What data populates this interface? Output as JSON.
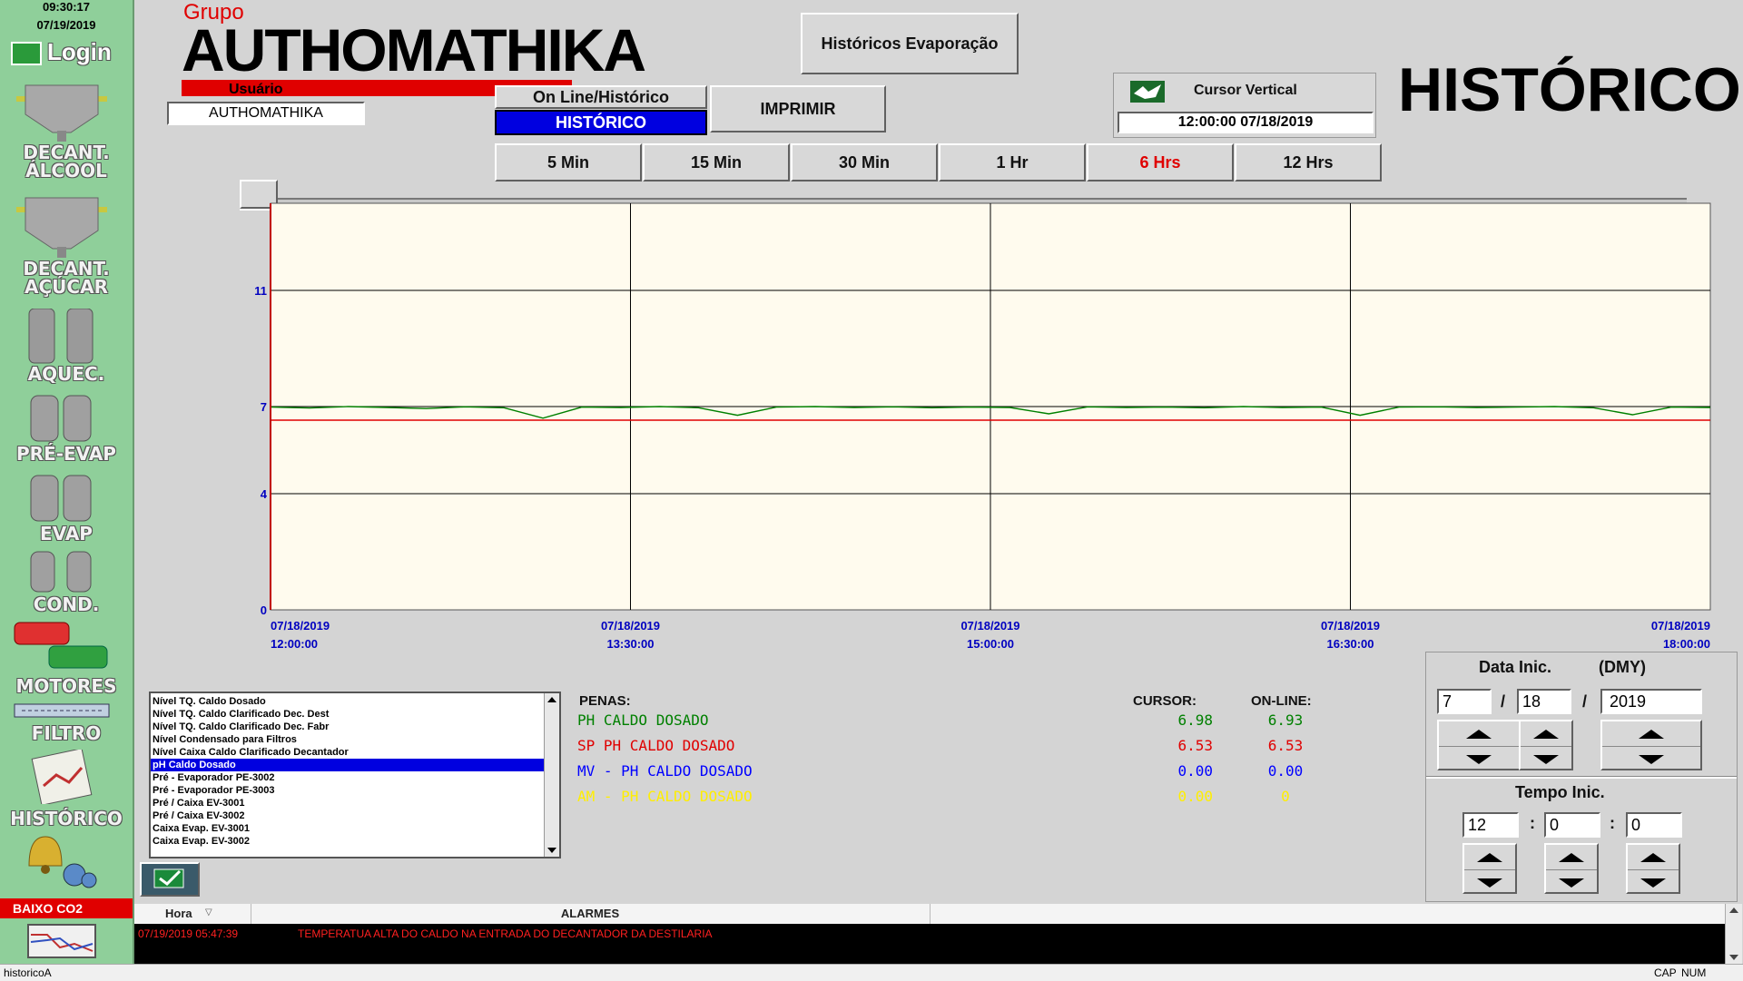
{
  "header": {
    "time": "09:30:17",
    "date": "07/19/2019",
    "login_label": "Login",
    "brand_top": "Grupo",
    "brand_name": "AUTHOMATHIKA",
    "user_label": "Usuário",
    "user_value": "AUTHOMATHIKA",
    "page_title": "HISTÓRICO"
  },
  "sidebar": {
    "items": [
      {
        "label": "DECANT.\nÁLCOOL"
      },
      {
        "label": "DECANT.\nAÇÚCAR"
      },
      {
        "label": "AQUEC."
      },
      {
        "label": "PRÉ-EVAP"
      },
      {
        "label": "EVAP"
      },
      {
        "label": "COND."
      },
      {
        "label": "MOTORES"
      },
      {
        "label": "FILTRO"
      },
      {
        "label": "HISTÓRICO"
      }
    ],
    "alarm_badge": "BAIXO CO2"
  },
  "toolbar": {
    "historicos_button": "Históricos Evaporação",
    "mode_label": "On Line/Histórico",
    "mode_value": "HISTÓRICO",
    "print_button": "IMPRIMIR",
    "cursor_title": "Cursor Vertical",
    "cursor_value": "12:00:00 07/18/2019",
    "ranges": [
      "5 Min",
      "15 Min",
      "30 Min",
      "1 Hr",
      "6 Hrs",
      "12 Hrs"
    ],
    "active_range": "6 Hrs"
  },
  "chart_data": {
    "type": "line",
    "ylim": [
      0,
      14
    ],
    "y_ticks": [
      "11",
      "7",
      "4",
      "0"
    ],
    "x_ticks": [
      {
        "date": "07/18/2019",
        "time": "12:00:00"
      },
      {
        "date": "07/18/2019",
        "time": "13:30:00"
      },
      {
        "date": "07/18/2019",
        "time": "15:00:00"
      },
      {
        "date": "07/18/2019",
        "time": "16:30:00"
      },
      {
        "date": "07/18/2019",
        "time": "18:00:00"
      }
    ],
    "series": [
      {
        "color": "#008000",
        "values": [
          6.98,
          6.95,
          7.0,
          6.97,
          6.93,
          6.99,
          6.96,
          6.6,
          6.98,
          6.97,
          7.0,
          6.96,
          6.7,
          6.98,
          7.0,
          6.97,
          6.99,
          6.96,
          6.98,
          6.97,
          6.75,
          6.99,
          6.97,
          6.98,
          6.96,
          7.0,
          6.97,
          6.98,
          6.7,
          6.98,
          6.99,
          6.97,
          6.98,
          7.0,
          6.96,
          6.72,
          6.98,
          6.97
        ]
      },
      {
        "color": "#e00000",
        "values": [
          6.53,
          6.53
        ]
      }
    ]
  },
  "tag_list": {
    "items": [
      "Nível TQ. Caldo Dosado",
      "Nível TQ. Caldo Clarificado Dec. Dest",
      "Nível TQ. Caldo Clarificado Dec. Fabr",
      "Nível Condensado para Filtros",
      "Nível Caixa Caldo Clarificado Decantador",
      "pH Caldo Dosado",
      "Pré - Evaporador PE-3002",
      "Pré - Evaporador PE-3003",
      "Pré / Caixa EV-3001",
      "Pré / Caixa EV-3002",
      "Caixa Evap. EV-3001",
      "Caixa Evap. EV-3002"
    ],
    "selected": "pH Caldo Dosado"
  },
  "pens": {
    "header_penas": "PENAS:",
    "header_cursor": "CURSOR:",
    "header_online": "ON-LINE:",
    "rows": [
      {
        "name": "PH CALDO DOSADO",
        "cursor": "6.98",
        "online": "6.93",
        "color": "#008000",
        "vcolor": "#008000"
      },
      {
        "name": "SP PH CALDO DOSADO",
        "cursor": "6.53",
        "online": "6.53",
        "color": "#e00000",
        "vcolor": "#e00000"
      },
      {
        "name": "MV - PH CALDO DOSADO",
        "cursor": "0.00",
        "online": "0.00",
        "color": "#0000ff",
        "vcolor": "#0000ff"
      },
      {
        "name": "AM - PH CALDO DOSADO",
        "cursor": "0.00",
        "online": "0",
        "color": "#ffee00",
        "vcolor": "#ffee00"
      }
    ]
  },
  "date_panel": {
    "title": "Data Inic.",
    "format": "(DMY)",
    "month": "7",
    "day": "18",
    "year": "2019",
    "sep": "/"
  },
  "time_panel": {
    "title": "Tempo Inic.",
    "hour": "12",
    "minute": "0",
    "second": "0",
    "sep": ":"
  },
  "alarms": {
    "col_hora": "Hora",
    "col_alarmes": "ALARMES",
    "rows": [
      {
        "time": "07/19/2019 05:47:39",
        "message": "TEMPERATUA ALTA DO CALDO NA ENTRADA DO DECANTADOR DA DESTILARIA"
      }
    ]
  },
  "statusbar": {
    "left": "historicoA",
    "caps": "CAP",
    "num": "NUM"
  }
}
